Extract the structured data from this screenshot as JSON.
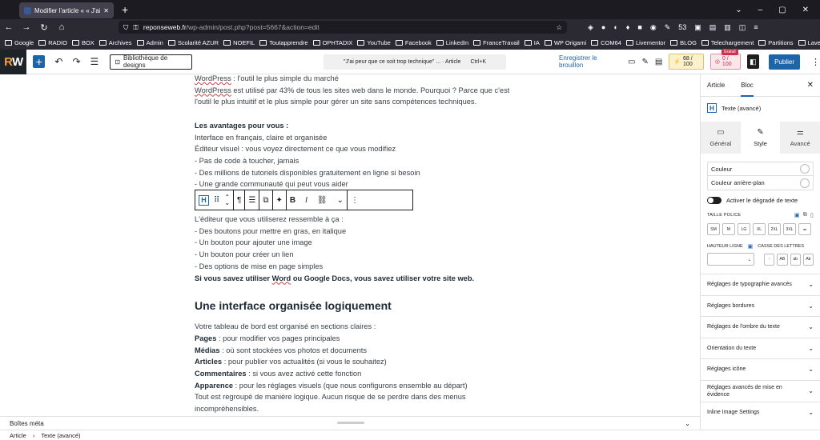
{
  "browser": {
    "tab_title": "Modifier l'article « « J'ai peur q",
    "url_host": "reponseweb.fr",
    "url_path": "/wp-admin/post.php?post=5667&action=edit",
    "ext_badge": "53",
    "bookmarks": [
      "Google",
      "RADIO",
      "BOX",
      "Archives",
      "Admin",
      "Scolarité AZUR",
      "NOEFIL",
      "Toutapprendre",
      "OPHTADIX",
      "YouTube",
      "Facebook",
      "LinkedIn",
      "FranceTravail",
      "IA",
      "WP Origami",
      "COM64",
      "Livementor",
      "BLOG",
      "Telechargement",
      "Partitions",
      "Lave vaisselle",
      "Testeur de site"
    ]
  },
  "wp": {
    "logo_a": "R",
    "logo_b": "W",
    "design_library": "Bibliothèque de designs",
    "command_title": "\"J'ai peur que ce soit trop technique\" ... · Article",
    "command_shortcut": "Ctrl+K",
    "save_draft": "Enregistrer le brouillon",
    "seo_score": "68 / 100",
    "readability_score": "0 / 100",
    "gratuit": "Gratuit",
    "publish": "Publier"
  },
  "content": {
    "l1_a": "WordPress",
    "l1_b": " : l'outil le plus simple du marché",
    "l2_a": "WordPress",
    "l2_b": " est utilisé par 43% de tous les sites web dans le monde. Pourquoi ? Parce que c'est",
    "l3": "l'outil le plus intuitif et le plus simple pour gérer un site sans compétences techniques.",
    "adv_title": "Les avantages pour vous :",
    "adv": [
      "Interface en français, claire et organisée",
      "Éditeur visuel : vous voyez directement ce que vous modifiez",
      "- Pas de code à toucher, jamais",
      "- Des millions de tutoriels disponibles gratuitement en ligne si besoin",
      "- Une grande communauté qui peut vous aider"
    ],
    "editor_intro": "L'éditeur que vous utiliserez ressemble à ça :",
    "editor_list": [
      "- Des boutons pour mettre en gras, en italique",
      "- Un bouton pour ajouter une image",
      "- Un bouton pour créer un lien",
      "- Des options de mise en page simples"
    ],
    "bold_a": "Si vous savez utiliser ",
    "bold_word": "Word",
    "bold_b": " ou Google Docs, vous savez utiliser votre site web.",
    "heading": "Une interface organisée logiquement",
    "dash_intro": "Votre tableau de bord est organisé en sections claires :",
    "dash": [
      {
        "k": "Pages",
        "v": " : pour modifier vos pages principales"
      },
      {
        "k": "Médias",
        "v": " : où sont stockées vos photos et documents"
      },
      {
        "k": "Articles",
        "v": " : pour publier vos actualités (si vous le souhaitez)"
      },
      {
        "k": "Commentaires",
        "v": " : si vous avez activé cette fonction"
      },
      {
        "k": "Apparence",
        "v": " : pour les réglages visuels (que nous configurons ensemble au départ)"
      }
    ],
    "end1": "Tout est regroupé de manière logique. Aucun risque de se perdre dans des menus",
    "end2": "incompréhensibles."
  },
  "blocktoolbar": {
    "h": "H",
    "pilcrow": "¶",
    "bold": "B",
    "italic": "I"
  },
  "footer": {
    "meta": "Boîtes méta",
    "crumb1": "Article",
    "crumb2": "Texte (avancé)"
  },
  "sidebar": {
    "tab_article": "Article",
    "tab_block": "Bloc",
    "block_icon": "H",
    "block_name": "Texte (avancé)",
    "subtabs": [
      "Général",
      "Style",
      "Avancé"
    ],
    "color_text": "Couleur",
    "color_bg": "Couleur arrière-plan",
    "gradient": "Activer le dégradé de texte",
    "font_size_label": "TAILLE POLICE",
    "font_sizes": [
      "SM",
      "M",
      "LG",
      "XL",
      "2XL",
      "3XL"
    ],
    "line_height_label": "HAUTEUR LIGNE",
    "letter_case_label": "CASSE DES LETTRES",
    "letter_case": [
      "-",
      "AB",
      "ab",
      "Ab"
    ],
    "panels": [
      "Réglages de typographie avancés",
      "Réglages bordures",
      "Réglages de l'ombre du texte",
      "Orientation du texte",
      "Réglages icône",
      "Réglages avancés de mise en évidence",
      "Inline Image Settings"
    ]
  }
}
